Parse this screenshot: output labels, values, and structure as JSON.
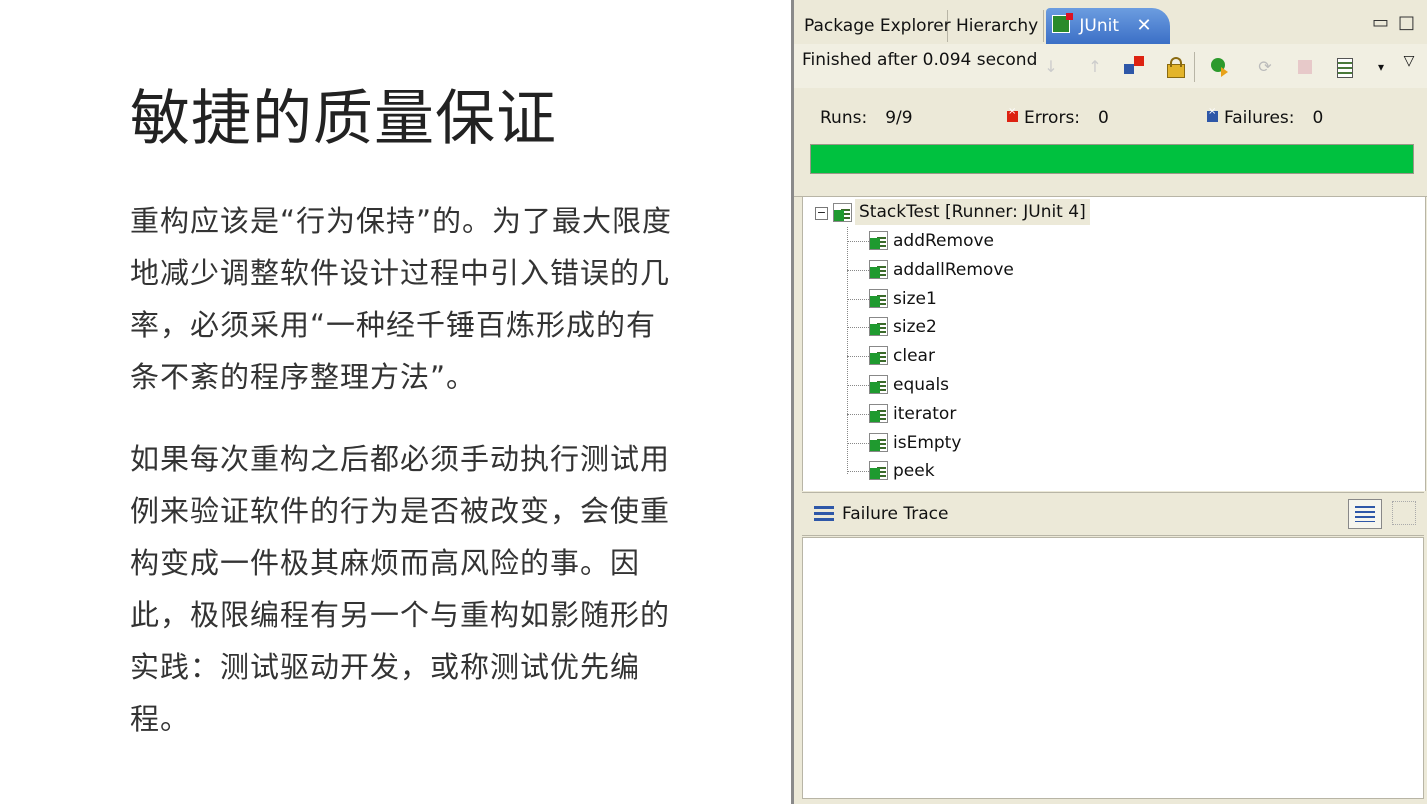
{
  "slide": {
    "title": "敏捷的质量保证",
    "paragraph1": "重构应该是“行为保持”的。为了最大限度地减少调整软件设计过程中引入错误的几率，必须采用“一种经千锤百炼形成的有条不紊的程序整理方法”。",
    "paragraph2": "如果每次重构之后都必须手动执行测试用例来验证软件的行为是否被改变，会使重构变成一件极其麻烦而高风险的事。因此，极限编程有另一个与重构如影随形的实践：测试驱动开发，或称测试优先编程。"
  },
  "eclipse": {
    "tabs": {
      "package_explorer": "Package Explorer",
      "hierarchy": "Hierarchy",
      "junit": "JUnit"
    },
    "close_glyph": "✕",
    "minimize_glyph": "▭",
    "maximize_glyph": "□",
    "status": "Finished after 0.094 second",
    "toolbar_glyphs": {
      "next_failure": "↓",
      "prev_failure": "↑",
      "dropdown": "▾",
      "view_menu": "▽"
    },
    "counts": {
      "runs_label": "Runs:",
      "runs_value": "9/9",
      "errors_label": "Errors:",
      "errors_value": "0",
      "failures_label": "Failures:",
      "failures_value": "0"
    },
    "progress": {
      "fraction": 1.0,
      "color": "#00c13f"
    },
    "tree": {
      "expand_glyph": "−",
      "root_label": "StackTest [Runner: JUnit 4]",
      "tests": [
        "addRemove",
        "addallRemove",
        "size1",
        "size2",
        "clear",
        "equals",
        "iterator",
        "isEmpty",
        "peek"
      ]
    },
    "failure_trace": {
      "label": "Failure Trace"
    }
  }
}
